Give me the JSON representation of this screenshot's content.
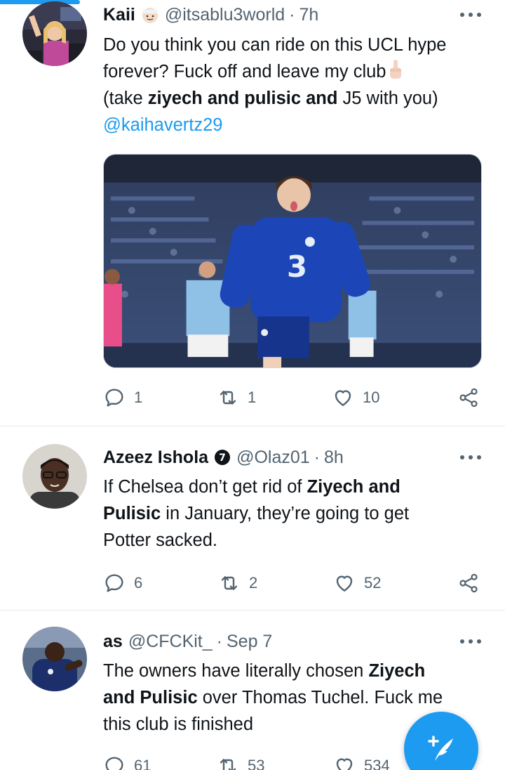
{
  "colors": {
    "accent": "#1d9bf0",
    "text": "#0f1419",
    "muted": "#536471",
    "divider": "#e4e8eb"
  },
  "tweets": [
    {
      "name": "Kaii",
      "name_emoji": "person-with-headscarf-emoji",
      "handle": "@itsablu3world",
      "dot": "·",
      "time": "7h",
      "text": {
        "line1": "Do you think you can ride on this UCL hype",
        "line2a": "forever? Fuck off and leave my club",
        "line3a": "(take ",
        "line3b": "ziyech and pulisic and",
        "line3c": " J5 with you)",
        "mention": "@kaihavertz29"
      },
      "media": "photo-chelsea-player-celebrating",
      "replies": "1",
      "retweets": "1",
      "likes": "10"
    },
    {
      "name": "Azeez Ishola",
      "badge": "chelsea-badge-icon",
      "handle": "@Olaz01",
      "dot": "·",
      "time": "8h",
      "text": {
        "line1a": "If Chelsea don’t get rid of ",
        "line1b": "Ziyech and",
        "line2a": "Pulisic",
        "line2b": " in January, they’re going to get",
        "line3": "Potter sacked."
      },
      "replies": "6",
      "retweets": "2",
      "likes": "52"
    },
    {
      "name": "as",
      "handle": "@CFCKit_",
      "dot": "·",
      "time": "Sep 7",
      "text": {
        "line1a": "The owners have literally chosen ",
        "line1b": "Ziyech",
        "line2a": "and Pulisic",
        "line2b": " over Thomas Tuchel. Fuck me",
        "line3": "this club is finished"
      },
      "replies": "61",
      "retweets": "53",
      "likes": "534"
    }
  ],
  "compose_button": "compose-tweet-icon"
}
